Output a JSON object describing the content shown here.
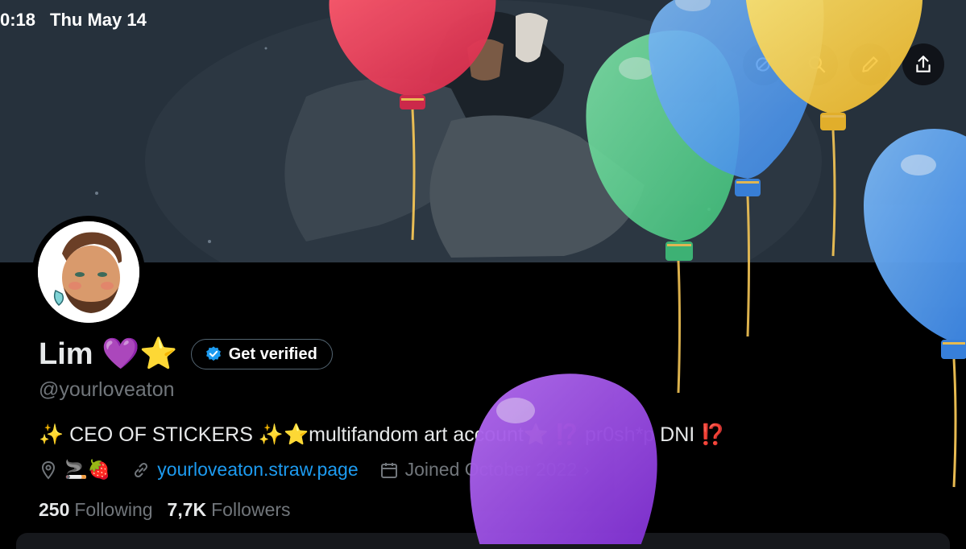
{
  "status_bar": {
    "time": "0:18",
    "date": "Thu May 14"
  },
  "header_buttons": [
    "search-globe-icon",
    "search-icon",
    "edit-pencil-icon",
    "share-icon"
  ],
  "profile": {
    "display_name": "Lim 💜⭐",
    "verify_label": "Get verified",
    "handle": "@yourloveaton",
    "bio": "✨ CEO OF STICKERS ✨⭐multifandom art account⭐ ⁉️ pr0sh*p DNI ⁉️",
    "location": "🚬🍓",
    "website": "yourloveaton.straw.page",
    "joined": "Joined October 2022",
    "following_count": "250",
    "following_label": "Following",
    "followers_count": "7,7K",
    "followers_label": "Followers"
  },
  "colors": {
    "link": "#1d9bf0",
    "muted": "#71767b",
    "verified": "#1d9bf0"
  },
  "balloons": [
    "red",
    "green",
    "blue",
    "yellow",
    "blue",
    "purple"
  ]
}
